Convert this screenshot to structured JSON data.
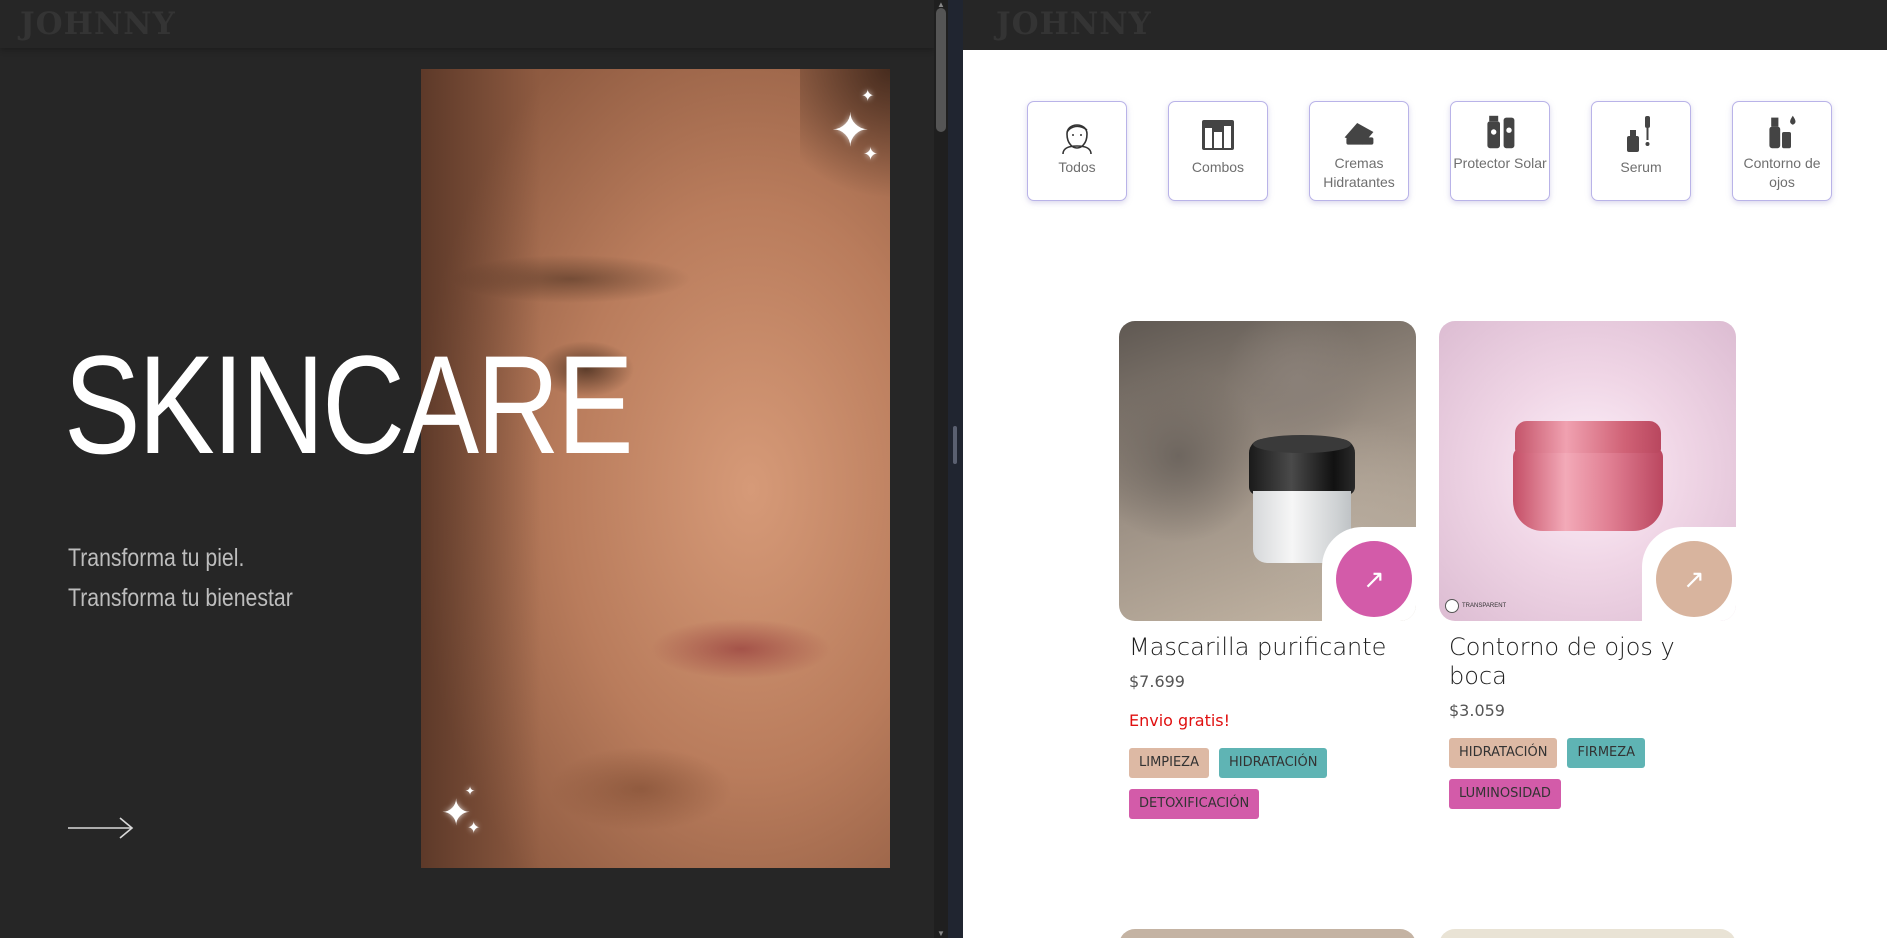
{
  "left": {
    "logo": "JOHNNY",
    "hero_title": "SKINCARE",
    "hero_subtitle": "Transforma tu piel. Transforma tu bienestar",
    "next_icon": "arrow-right-icon"
  },
  "right": {
    "logo": "JOHNNY",
    "categories": [
      {
        "label": "Todos",
        "icon": "face-icon"
      },
      {
        "label": "Combos",
        "icon": "combo-box-icon"
      },
      {
        "label": "Cremas Hidratantes",
        "icon": "cream-jar-icon"
      },
      {
        "label": "Protector Solar",
        "icon": "sunscreen-icon"
      },
      {
        "label": "Serum",
        "icon": "serum-dropper-icon"
      },
      {
        "label": "Contorno de ojos",
        "icon": "eye-contour-icon"
      }
    ],
    "products": [
      {
        "name": "Mascarilla purificante",
        "price": "$7.699",
        "promo": "Envio gratis!",
        "tags": [
          "LIMPIEZA",
          "HIDRATACIÓN",
          "DETOXIFICACIÓN"
        ],
        "button_icon": "arrow-up-right-icon",
        "button_color": "#d35ba9"
      },
      {
        "name": "Contorno de ojos y boca",
        "price": "$3.059",
        "brand_mark": "TRANSPARENT",
        "tags": [
          "HIDRATACIÓN",
          "FIRMEZA",
          "LUMINOSIDAD"
        ],
        "button_icon": "arrow-up-right-icon",
        "button_color": "#d8b49e"
      }
    ]
  },
  "colors": {
    "dark_bg": "#262626",
    "category_border": "#b9b3e8",
    "tag_limpieza": "#ddb9a4",
    "tag_hidratacion_teal": "#5fb4b4",
    "tag_magenta": "#d35ba9",
    "promo_red": "#e01010"
  }
}
